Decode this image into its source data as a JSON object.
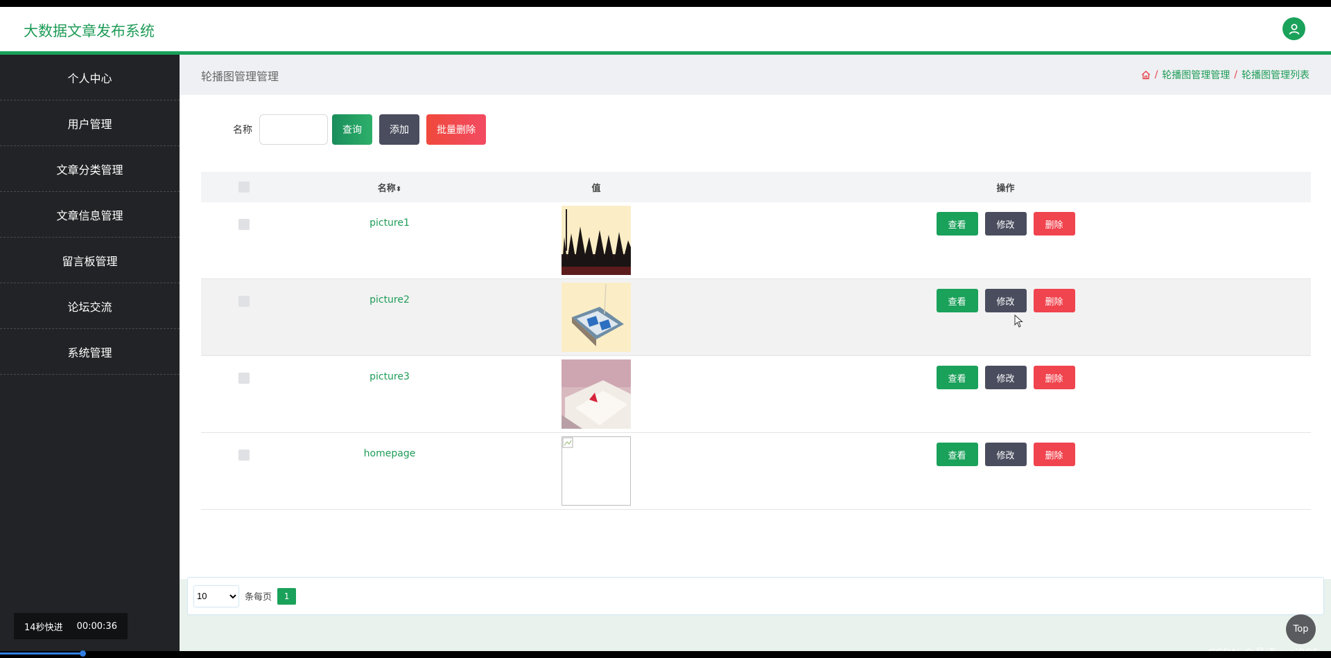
{
  "header": {
    "title": "大数据文章发布系统"
  },
  "sidebar": {
    "items": [
      {
        "label": "个人中心"
      },
      {
        "label": "用户管理"
      },
      {
        "label": "文章分类管理"
      },
      {
        "label": "文章信息管理"
      },
      {
        "label": "留言板管理"
      },
      {
        "label": "论坛交流"
      },
      {
        "label": "系统管理"
      }
    ]
  },
  "video": {
    "skip_label": "14秒快进",
    "time": "00:00:36"
  },
  "page": {
    "heading": "轮播图管理管理",
    "breadcrumb": [
      "轮播图管理管理",
      "轮播图管理列表"
    ],
    "separator": "/"
  },
  "search": {
    "label": "名称",
    "value": "",
    "query_button": "查询",
    "add_button": "添加",
    "batch_delete_button": "批量删除"
  },
  "table": {
    "columns": {
      "name": "名称",
      "sort_glyph": "⬍",
      "value": "值",
      "ops": "操作"
    },
    "actions": {
      "view": "查看",
      "edit": "修改",
      "delete": "删除"
    },
    "rows": [
      {
        "name": "picture1"
      },
      {
        "name": "picture2"
      },
      {
        "name": "picture3"
      },
      {
        "name": "homepage"
      }
    ]
  },
  "pagination": {
    "page_size": "10",
    "page_size_options": [
      "10"
    ],
    "per_page_label": "条每页",
    "current_page": "1"
  },
  "top_button": "Top",
  "watermark": "CSDN @晶涛cxsj985",
  "colors": {
    "accent": "#1aa15a",
    "sidebar": "#222326",
    "danger": "#f0444e",
    "dark_button": "#4a4d5e"
  }
}
